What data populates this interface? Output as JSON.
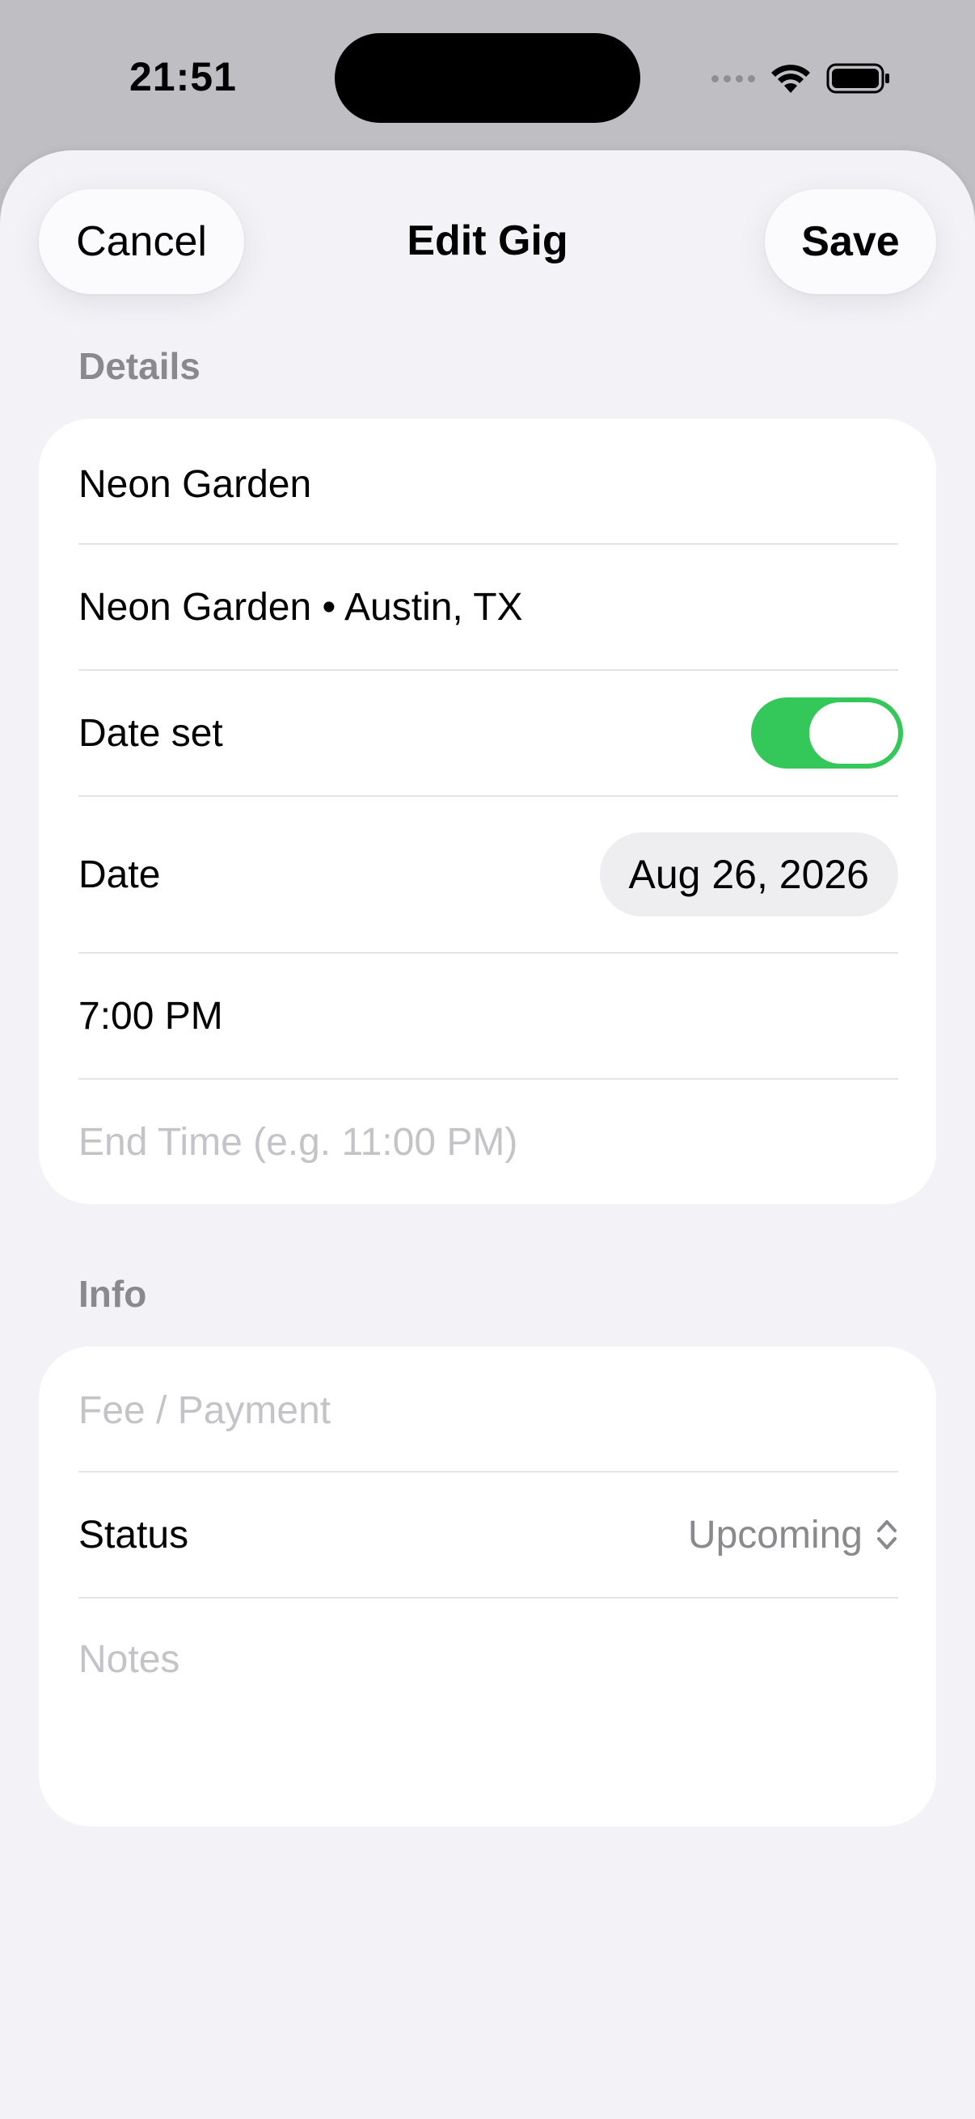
{
  "status_bar": {
    "time": "21:51"
  },
  "nav": {
    "cancel_label": "Cancel",
    "title": "Edit Gig",
    "save_label": "Save"
  },
  "details": {
    "section_label": "Details",
    "name_value": "Neon Garden",
    "venue_value": "Neon Garden • Austin, TX",
    "date_set_label": "Date set",
    "date_set_on": true,
    "date_label": "Date",
    "date_value": "Aug 26, 2026",
    "start_time_value": "7:00 PM",
    "end_time_placeholder": "End Time (e.g. 11:00 PM)"
  },
  "info": {
    "section_label": "Info",
    "fee_placeholder": "Fee / Payment",
    "status_label": "Status",
    "status_value": "Upcoming",
    "notes_placeholder": "Notes"
  },
  "colors": {
    "toggle_on": "#34c759",
    "background": "#f2f2f7",
    "secondary_text": "#8a8a8e"
  },
  "icons": [
    "cellular-dots-icon",
    "wifi-icon",
    "battery-icon",
    "chevron-up-down-icon"
  ]
}
